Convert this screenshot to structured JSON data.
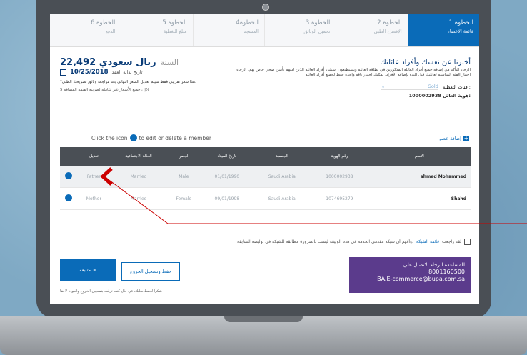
{
  "steps": [
    {
      "num": "الخطوة 6",
      "sub": "الدفع",
      "active": false
    },
    {
      "num": "الخطوة 5",
      "sub": "مبلغ التغطية",
      "active": false
    },
    {
      "num": "4الخطوة",
      "sub": "المسجد",
      "active": false
    },
    {
      "num": "الخطوة 3",
      "sub": "تحميل الوثائق",
      "active": false
    },
    {
      "num": "الخطوة 2",
      "sub": "الإفصاح الطبي",
      "active": false
    },
    {
      "num": "الخطوة 1",
      "sub": "قائمة الأعضاء",
      "active": true
    }
  ],
  "summary": {
    "price_label": "السنة",
    "price_value": "22,492 ريال سعودي",
    "date": "10/25/2018",
    "start_label": "تاريخ بداية العقد",
    "note": "*هذا سعر تقريبي فقط سيتم تعديل السعر النهائي بعد مراجعة وثائق تصريحك الطبي.",
    "note2": "إن جميع الأسعار غير شاملة لضريبة القيمة المضافة 5%"
  },
  "member_section": {
    "title": "أخبرنا عن نفسك وأفراد عائلتك",
    "desc": "الرجاء التأكد من إضافة جميع أفراد العائلة المذكورين في بطاقة العائلة وتستطيعون استثناء أفراد العائلة الذين لديهم تأمين صحي خاص بهم. الرجاء اختيار الفئة المناسبة لعائلتك قبل البدء بإضافة الأفراد. يمكنك اختيار باقة واحدة فقط لجميع أفراد العائلة",
    "category_label": "فئات التغطية :",
    "category_value": "Gold",
    "policy_label": "هوية العائل:",
    "policy_value": "1000002938"
  },
  "hint": {
    "before": "Click the icon",
    "after": "to edit or delete a member"
  },
  "add_member_label": "إضافة عضو",
  "table": {
    "headers": [
      "تعديل",
      "الحالة الاجتماعية",
      "الجنس",
      "تاريخ الميلاد",
      "الجنسية",
      "رقم الهوية",
      "الاسم"
    ],
    "rows": [
      [
        "",
        "Father",
        "Married",
        "Male",
        "01/01/1990",
        "Saudi Arabia",
        "1000002938",
        "ahmed Mohammed"
      ],
      [
        "",
        "Mother",
        "Married",
        "Female",
        "09/01/1998",
        "Saudi Arabia",
        "1074695279",
        "Shahd"
      ]
    ]
  },
  "agree": {
    "text_before": "لقد راجعت",
    "link": "قائمة الشبكة",
    "text_after": "وأفهم أن شبكة مقدمي الخدمة في هذه الوثيقة ليست بالضرورة مطابقة للشبكة في بوليصة السابقة."
  },
  "buttons": {
    "next": "متابعة >",
    "save": "حفظ وتسجيل الخروج"
  },
  "footer_note": "شكراً لحفظ طلبك، في حال كنت ترغب بتسجيل الخروج والعودة لاحقاً",
  "help": {
    "line1": "للمساعدة الرجاء الاتصال على",
    "phone": "8001160500",
    "email": "BA.E-commerce@bupa.com.sa"
  },
  "colors": {
    "primary": "#0a6bb8",
    "dark": "#4a4f55",
    "purple": "#5b3b8c",
    "arrow": "#cc0000"
  }
}
